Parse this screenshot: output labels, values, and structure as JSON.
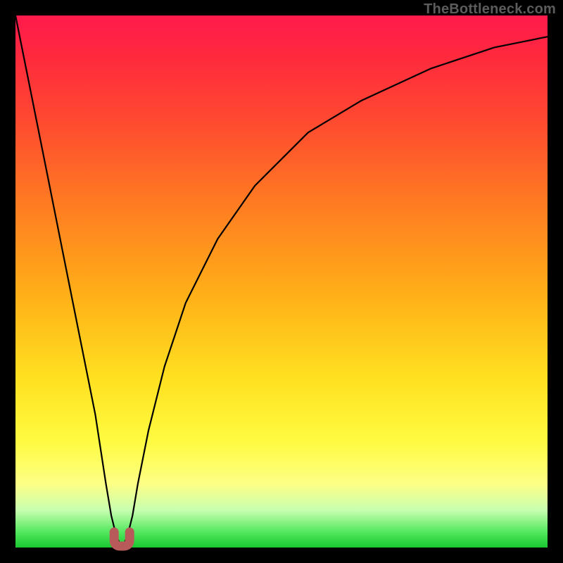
{
  "watermark": "TheBottleneck.com",
  "chart_data": {
    "type": "line",
    "title": "",
    "xlabel": "",
    "ylabel": "",
    "x_range": [
      0,
      100
    ],
    "y_range": [
      0,
      100
    ],
    "grid": false,
    "legend": false,
    "gradient_colors": {
      "top": "#ff1a4d",
      "bottom": "#18c830"
    },
    "series": [
      {
        "name": "bottleneck-curve",
        "x": [
          0,
          3,
          6,
          9,
          12,
          15,
          17,
          18,
          19,
          20,
          21,
          22,
          23,
          25,
          28,
          32,
          38,
          45,
          55,
          65,
          78,
          90,
          100
        ],
        "values": [
          100,
          85,
          70,
          55,
          40,
          25,
          12,
          6,
          2,
          0,
          2,
          6,
          12,
          22,
          34,
          46,
          58,
          68,
          78,
          84,
          90,
          94,
          96
        ]
      }
    ],
    "marker": {
      "x": 20,
      "value": 0,
      "shape": "U"
    }
  }
}
